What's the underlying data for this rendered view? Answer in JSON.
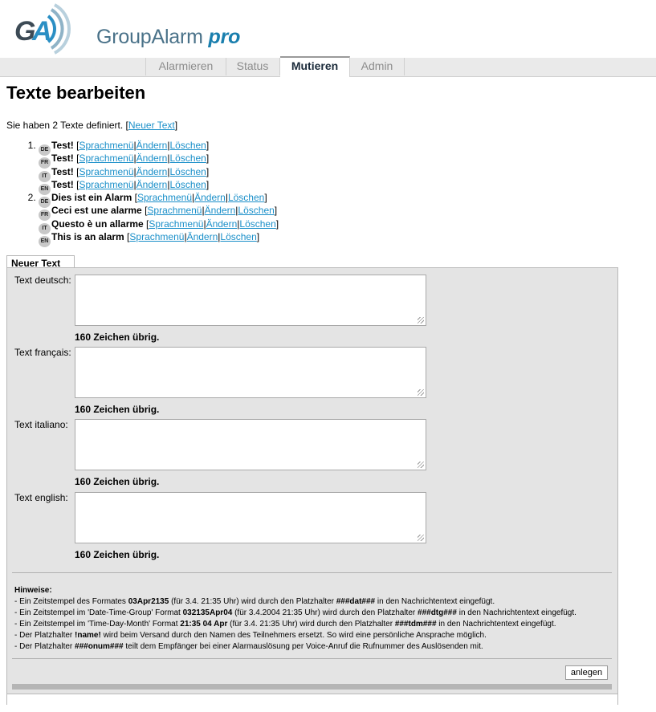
{
  "brand": {
    "name": "GroupAlarm",
    "suffix": "pro",
    "logo_letters": "GA"
  },
  "nav": {
    "tabs": [
      {
        "label": "Alarmieren"
      },
      {
        "label": "Status"
      },
      {
        "label": "Mutieren",
        "active": true
      },
      {
        "label": "Admin"
      }
    ]
  },
  "page": {
    "title": "Texte bearbeiten",
    "intro_prefix": "Sie haben 2 Texte definiert. [",
    "new_text_link": "Neuer Text",
    "intro_suffix": "]"
  },
  "actions": {
    "menu": "Sprachmenü",
    "edit": "Ändern",
    "delete": "Löschen",
    "open": "[",
    "sep": "|",
    "close": "]"
  },
  "texts": [
    {
      "entries": [
        {
          "lang": "DE",
          "text": "Test!"
        },
        {
          "lang": "FR",
          "text": "Test!"
        },
        {
          "lang": "IT",
          "text": "Test!"
        },
        {
          "lang": "EN",
          "text": "Test!"
        }
      ]
    },
    {
      "entries": [
        {
          "lang": "DE",
          "text": "Dies ist ein Alarm"
        },
        {
          "lang": "FR",
          "text": "Ceci est une alarme"
        },
        {
          "lang": "IT",
          "text": "Questo è un allarme"
        },
        {
          "lang": "EN",
          "text": "This is an alarm"
        }
      ]
    }
  ],
  "form": {
    "tab_label": "Neuer Text",
    "fields": [
      {
        "label": "Text deutsch:",
        "value": "",
        "remaining": "160 Zeichen übrig."
      },
      {
        "label": "Text français:",
        "value": "",
        "remaining": "160 Zeichen übrig."
      },
      {
        "label": "Text italiano:",
        "value": "",
        "remaining": "160 Zeichen übrig."
      },
      {
        "label": "Text english:",
        "value": "",
        "remaining": "160 Zeichen übrig."
      }
    ],
    "hints_title": "Hinweise:",
    "hints": [
      [
        "- Ein Zeitstempel des Formates ",
        "03Apr2135",
        " (für 3.4. 21:35 Uhr) wird durch den Platzhalter ",
        "###dat###",
        " in den Nachrichtentext eingefügt."
      ],
      [
        "- Ein Zeitstempel im 'Date-Time-Group' Format ",
        "032135Apr04",
        " (für 3.4.2004 21:35 Uhr) wird durch den Platzhalter ",
        "###dtg###",
        " in den Nachrichtentext eingefügt."
      ],
      [
        "- Ein Zeitstempel im 'Time-Day-Month' Format ",
        "21:35 04 Apr",
        " (für 3.4. 21:35 Uhr) wird durch den Platzhalter ",
        "###tdm###",
        " in den Nachrichtentext eingefügt."
      ],
      [
        "- Der Platzhalter ",
        "!name!",
        " wird beim Versand durch den Namen des Teilnehmers ersetzt. So wird eine persönliche Ansprache möglich.",
        "",
        ""
      ],
      [
        "- Der Platzhalter ",
        "###onum###",
        " teilt dem Empfänger bei einer Alarmauslösung per Voice-Anruf die Rufnummer des Auslösenden mit.",
        "",
        ""
      ]
    ],
    "submit_label": "anlegen"
  },
  "colors": {
    "link": "#1a8fc9",
    "brand_text": "#4a7289",
    "brand_pro": "#1a7fae",
    "panel_bg": "#e4e4e4"
  }
}
